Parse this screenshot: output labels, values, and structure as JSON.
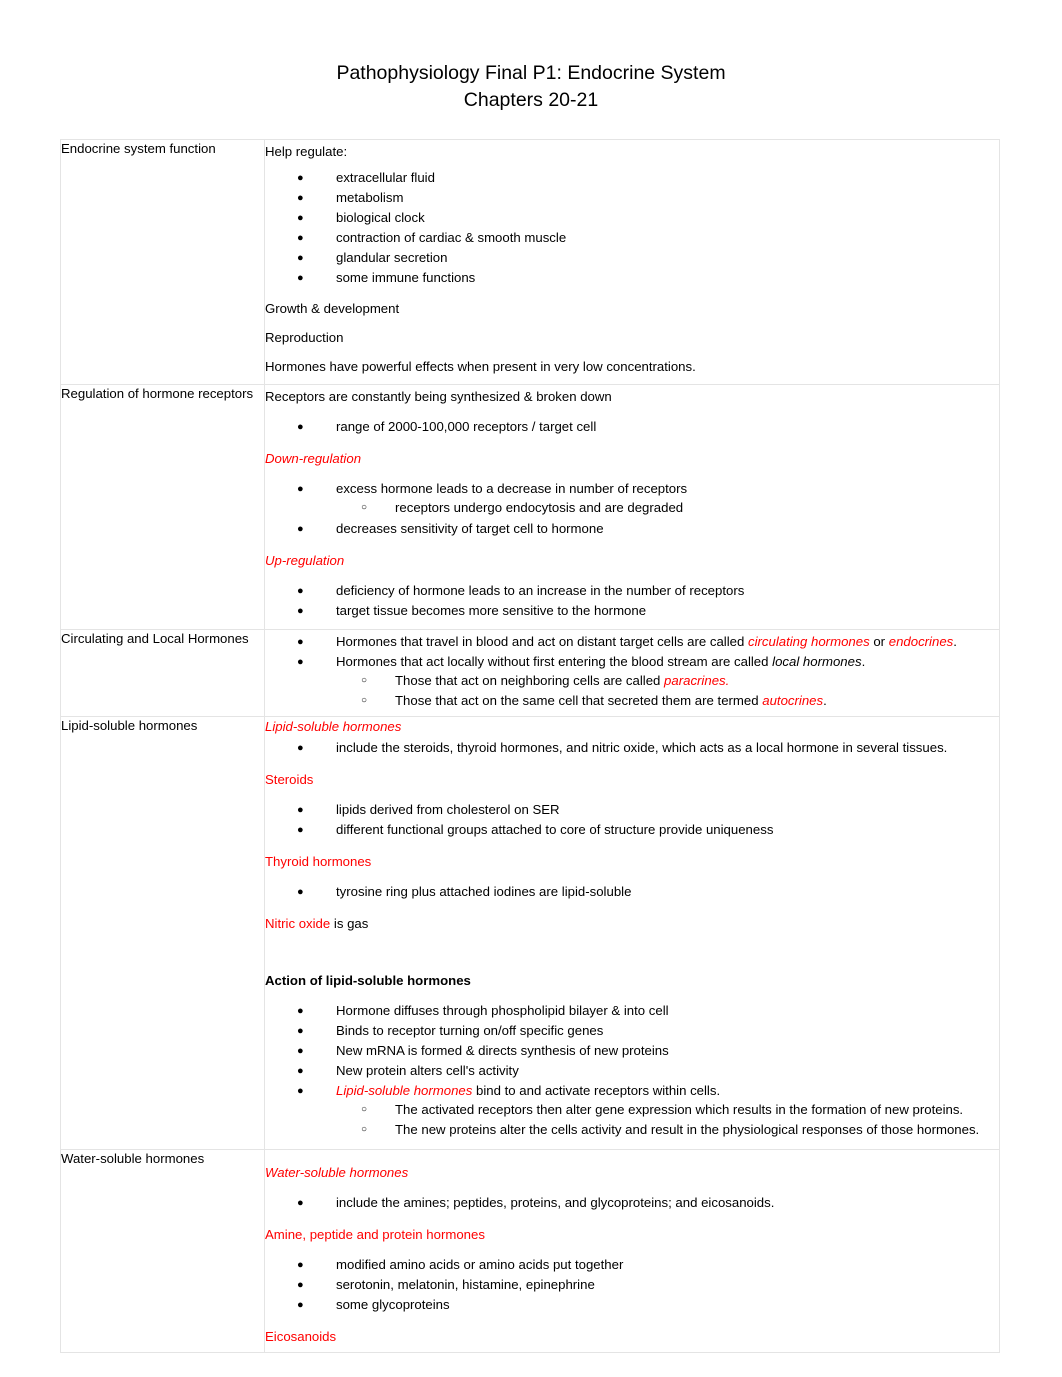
{
  "document": {
    "title_line1": "Pathophysiology Final P1: Endocrine System",
    "title_line2": "Chapters 20-21"
  },
  "colors": {
    "accent_red": "#ff0000",
    "text": "#000000",
    "border": "#e4e4e4"
  },
  "bullets": {
    "level1_glyph": "●",
    "level2_glyph": "○"
  },
  "rows": {
    "r1": {
      "term": "Endocrine system function",
      "intro": "Help regulate:",
      "items": [
        "extracellular fluid",
        "metabolism",
        "biological clock",
        "contraction of cardiac & smooth muscle",
        "glandular secretion",
        "some immune functions"
      ],
      "p_growth": "Growth & development",
      "p_reproduction": "Reproduction",
      "p_hormones": "Hormones have powerful effects when present in very low concentrations."
    },
    "r2": {
      "term": "Regulation of hormone receptors",
      "intro": "Receptors are constantly being synthesized & broken down",
      "range_item": "range of 2000-100,000 receptors / target cell",
      "down_heading": "Down-regulation",
      "down_item1": "excess hormone leads to a decrease in number of receptors",
      "down_sub1": "receptors undergo endocytosis and are degraded",
      "down_item2": "decreases sensitivity of target cell to hormone",
      "up_heading": "Up-regulation",
      "up_item1": "deficiency of hormone leads to an increase in the number of receptors",
      "up_item2": "target tissue becomes more sensitive to the hormone"
    },
    "r3": {
      "term": "Circulating and Local Hormones",
      "item1_a": "Hormones that travel in blood and act on distant target cells are called ",
      "item1_em1": "circulating hormones",
      "item1_b": " or ",
      "item1_em2": "endocrines",
      "item1_c": ".",
      "item2_a": "Hormones that act locally without first entering the blood stream are called ",
      "item2_em": "local hormones",
      "item2_b": ".",
      "sub1_a": "Those that act on neighboring cells are called ",
      "sub1_em": "paracrines.",
      "sub2_a": "Those that act on the same cell that secreted them are termed ",
      "sub2_em": "autocrines",
      "sub2_b": "."
    },
    "r4": {
      "term": "Lipid-soluble hormones",
      "heading_lipid": "Lipid-soluble hormones",
      "lipid_item": "include the steroids, thyroid hormones, and nitric oxide, which acts as a local hormone in several tissues.",
      "heading_steroids": "Steroids",
      "steroid_item1": "lipids derived from cholesterol on SER",
      "steroid_item2": "different functional groups attached to core of structure provide uniqueness",
      "heading_thyroid": "Thyroid hormones",
      "thyroid_item": "tyrosine ring plus attached iodines are lipid-soluble",
      "nitric_red": "Nitric oxide",
      "nitric_rest": " is gas",
      "heading_action": "Action of lipid-soluble hormones",
      "action_item1": "Hormone diffuses through phospholipid bilayer & into cell",
      "action_item2": "Binds to receptor turning on/off specific genes",
      "action_item3": "New mRNA is formed & directs synthesis of new proteins",
      "action_item4": "New protein alters cell's activity",
      "action_item5_em": "Lipid-soluble hormones",
      "action_item5_rest": " bind to and activate receptors within cells.",
      "action_sub1": "The activated receptors then alter gene expression which results in the formation of new proteins.",
      "action_sub2": "The new proteins alter the cells activity and result in the physiological responses of those hormones."
    },
    "r5": {
      "term": "Water-soluble hormones",
      "heading_water": "Water-soluble hormones",
      "water_item": "include the amines; peptides, proteins, and glycoproteins; and eicosanoids.",
      "heading_amine": "Amine, peptide and protein hormones",
      "amine_item1": "modified amino acids or amino acids put together",
      "amine_item2": "serotonin, melatonin, histamine, epinephrine",
      "amine_item3": "some glycoproteins",
      "heading_eicosanoids": "Eicosanoids"
    }
  }
}
